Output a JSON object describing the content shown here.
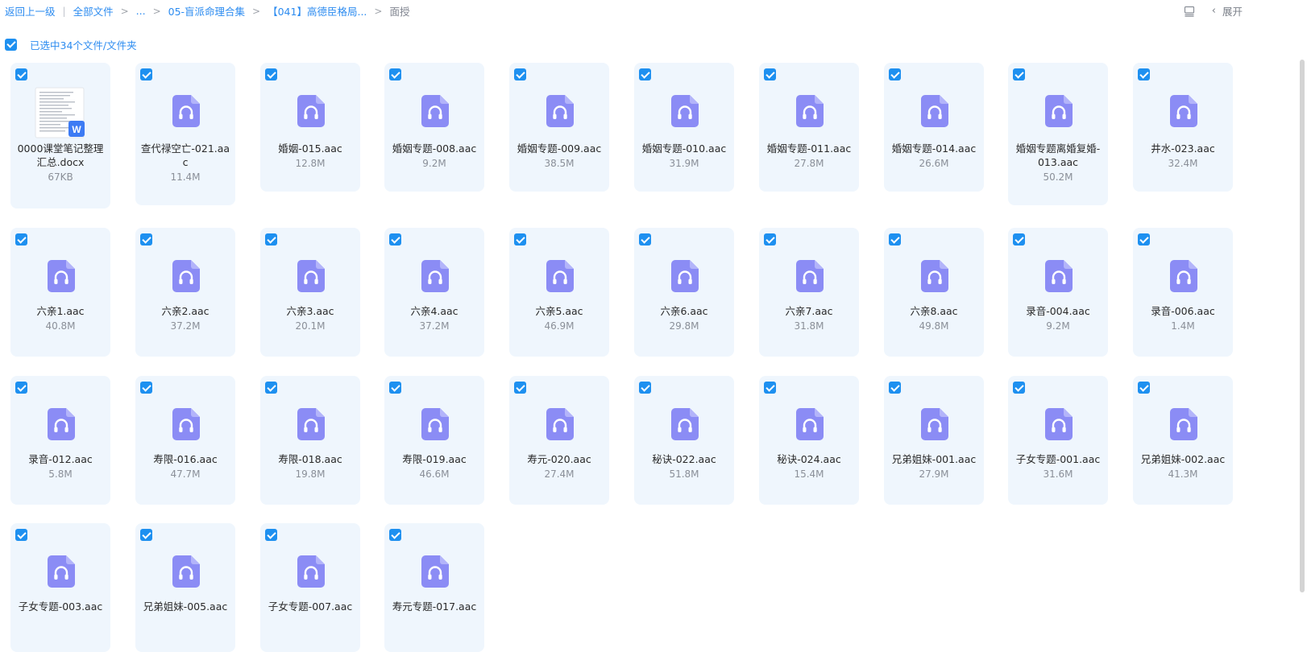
{
  "breadcrumb": {
    "back": "返回上一级",
    "divider": "|",
    "all_files": "全部文件",
    "gt": ">",
    "ellipsis": "...",
    "folder1": "05-盲派命理合集",
    "folder2": "【041】高德臣格局...",
    "current": "面授"
  },
  "toolbar": {
    "expand_label": "展开"
  },
  "selection": {
    "label": "已选中34个文件/文件夹"
  },
  "colors": {
    "accent": "#1e90f0",
    "tile_bg": "#eff6fd",
    "audio_icon": "#8b8cf5"
  },
  "files": [
    {
      "type": "docx",
      "name": "0000课堂笔记整理汇总.docx",
      "size": "67KB",
      "checked": true
    },
    {
      "type": "audio",
      "name": "查代禄空亡-021.aac",
      "size": "11.4M",
      "checked": true
    },
    {
      "type": "audio",
      "name": "婚姻-015.aac",
      "size": "12.8M",
      "checked": true
    },
    {
      "type": "audio",
      "name": "婚姻专题-008.aac",
      "size": "9.2M",
      "checked": true
    },
    {
      "type": "audio",
      "name": "婚姻专题-009.aac",
      "size": "38.5M",
      "checked": true
    },
    {
      "type": "audio",
      "name": "婚姻专题-010.aac",
      "size": "31.9M",
      "checked": true
    },
    {
      "type": "audio",
      "name": "婚姻专题-011.aac",
      "size": "27.8M",
      "checked": true
    },
    {
      "type": "audio",
      "name": "婚姻专题-014.aac",
      "size": "26.6M",
      "checked": true
    },
    {
      "type": "audio",
      "name": "婚姻专题离婚复婚-013.aac",
      "size": "50.2M",
      "checked": true
    },
    {
      "type": "audio",
      "name": "井水-023.aac",
      "size": "32.4M",
      "checked": true
    },
    {
      "type": "audio",
      "name": "六亲1.aac",
      "size": "40.8M",
      "checked": true
    },
    {
      "type": "audio",
      "name": "六亲2.aac",
      "size": "37.2M",
      "checked": true
    },
    {
      "type": "audio",
      "name": "六亲3.aac",
      "size": "20.1M",
      "checked": true
    },
    {
      "type": "audio",
      "name": "六亲4.aac",
      "size": "37.2M",
      "checked": true
    },
    {
      "type": "audio",
      "name": "六亲5.aac",
      "size": "46.9M",
      "checked": true
    },
    {
      "type": "audio",
      "name": "六亲6.aac",
      "size": "29.8M",
      "checked": true
    },
    {
      "type": "audio",
      "name": "六亲7.aac",
      "size": "31.8M",
      "checked": true
    },
    {
      "type": "audio",
      "name": "六亲8.aac",
      "size": "49.8M",
      "checked": true
    },
    {
      "type": "audio",
      "name": "录音-004.aac",
      "size": "9.2M",
      "checked": true
    },
    {
      "type": "audio",
      "name": "录音-006.aac",
      "size": "1.4M",
      "checked": true
    },
    {
      "type": "audio",
      "name": "录音-012.aac",
      "size": "5.8M",
      "checked": true
    },
    {
      "type": "audio",
      "name": "寿限-016.aac",
      "size": "47.7M",
      "checked": true
    },
    {
      "type": "audio",
      "name": "寿限-018.aac",
      "size": "19.8M",
      "checked": true
    },
    {
      "type": "audio",
      "name": "寿限-019.aac",
      "size": "46.6M",
      "checked": true
    },
    {
      "type": "audio",
      "name": "寿元-020.aac",
      "size": "27.4M",
      "checked": true
    },
    {
      "type": "audio",
      "name": "秘诀-022.aac",
      "size": "51.8M",
      "checked": true
    },
    {
      "type": "audio",
      "name": "秘诀-024.aac",
      "size": "15.4M",
      "checked": true
    },
    {
      "type": "audio",
      "name": "兄弟姐妹-001.aac",
      "size": "27.9M",
      "checked": true
    },
    {
      "type": "audio",
      "name": "子女专题-001.aac",
      "size": "31.6M",
      "checked": true
    },
    {
      "type": "audio",
      "name": "兄弟姐妹-002.aac",
      "size": "41.3M",
      "checked": true
    },
    {
      "type": "audio",
      "name": "子女专题-003.aac",
      "size": "",
      "checked": true
    },
    {
      "type": "audio",
      "name": "兄弟姐妹-005.aac",
      "size": "",
      "checked": true
    },
    {
      "type": "audio",
      "name": "子女专题-007.aac",
      "size": "",
      "checked": true
    },
    {
      "type": "audio",
      "name": "寿元专题-017.aac",
      "size": "",
      "checked": true
    }
  ]
}
